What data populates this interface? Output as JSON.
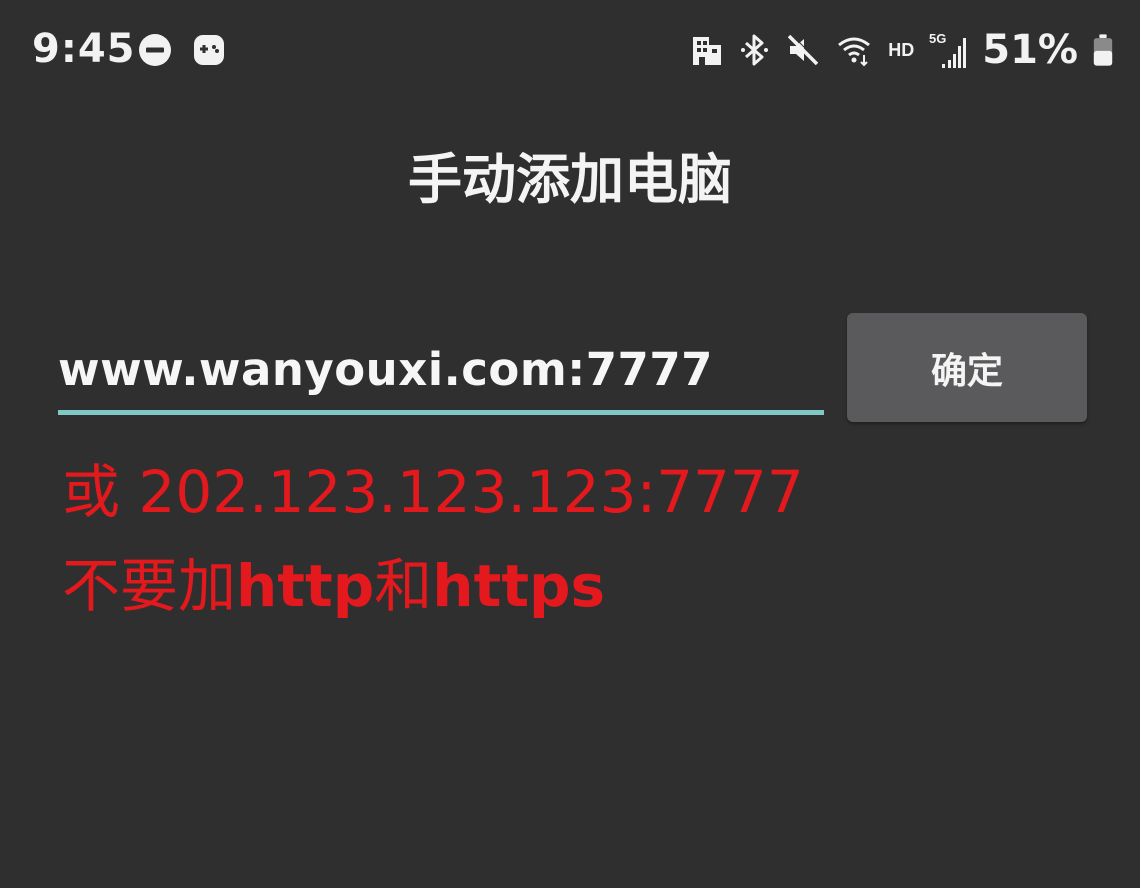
{
  "status_bar": {
    "time": "9:45",
    "left_icons": [
      "do-not-disturb-icon",
      "game-controller-icon"
    ],
    "right_icons": [
      "building-icon",
      "bluetooth-icon",
      "mute-icon",
      "wifi-icon",
      "signal-icon",
      "battery-icon"
    ],
    "hd_label": "HD",
    "network_label": "5G",
    "battery_percent": "51%"
  },
  "title": "手动添加电脑",
  "address_input": {
    "value": "www.wanyouxi.com:7777"
  },
  "confirm_label": "确定",
  "hint": {
    "prefix": "或",
    "example_ip": "202.123.123.123:7777",
    "line2_part1": "不要加",
    "line2_bold1": "http",
    "line2_part2": "和",
    "line2_bold2": "https"
  },
  "colors": {
    "background": "#2f2f2f",
    "accent_underline": "#7fc8c4",
    "hint_red": "#e3191d",
    "button_bg": "#5a5a5c",
    "text_light": "#f4f4f4"
  }
}
